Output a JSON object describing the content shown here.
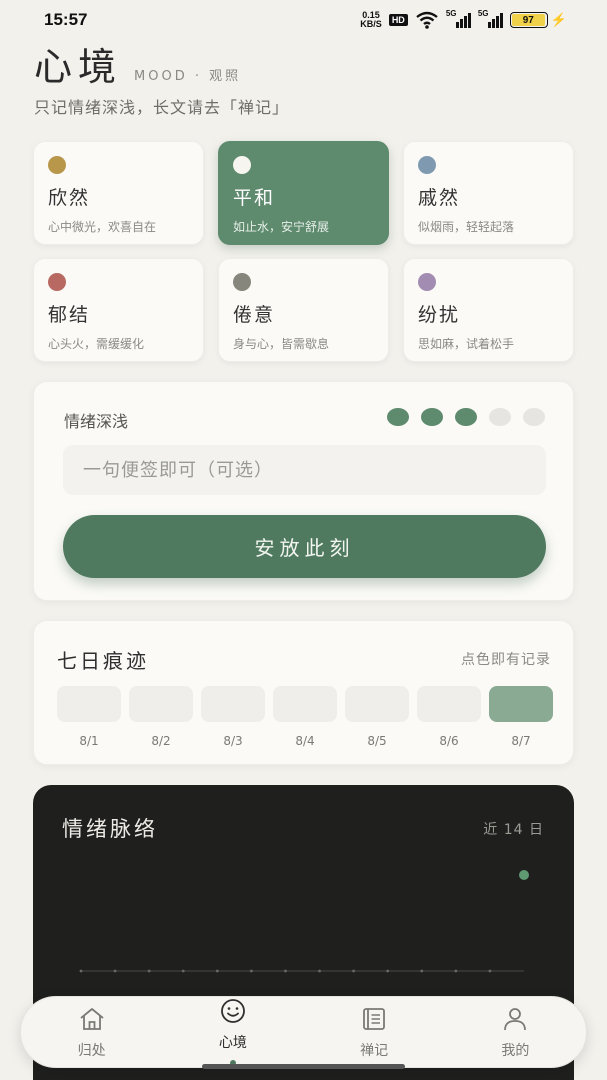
{
  "status_bar": {
    "time": "15:57",
    "net_speed_value": "0.15",
    "net_speed_unit": "KB/S",
    "hd_badge": "HD",
    "signal_1_label": "5G",
    "signal_2_label": "5G",
    "battery_percent": "97"
  },
  "header": {
    "title": "心境",
    "subtitle": "MOOD · 观照",
    "tagline": "只记情绪深浅，长文请去「禅记」"
  },
  "moods": [
    {
      "name": "欣然",
      "desc": "心中微光，欢喜自在",
      "color": "#b9974a",
      "selected": false
    },
    {
      "name": "平和",
      "desc": "如止水，安宁舒展",
      "color": "#f7f5ef",
      "selected": true
    },
    {
      "name": "戚然",
      "desc": "似烟雨，轻轻起落",
      "color": "#7f9ab0",
      "selected": false
    },
    {
      "name": "郁结",
      "desc": "心头火，需缓缓化",
      "color": "#b86a62",
      "selected": false
    },
    {
      "name": "倦意",
      "desc": "身与心，皆需歇息",
      "color": "#86867c",
      "selected": false
    },
    {
      "name": "纷扰",
      "desc": "思如麻，试着松手",
      "color": "#a38cb2",
      "selected": false
    }
  ],
  "intensity": {
    "label": "情绪深浅",
    "level": 3,
    "max": 5,
    "note_placeholder": "一句便签即可（可选）",
    "note_value": "",
    "submit_label": "安放此刻"
  },
  "week": {
    "title": "七日痕迹",
    "hint": "点色即有记录",
    "days": [
      {
        "label": "8/1",
        "recorded": false
      },
      {
        "label": "8/2",
        "recorded": false
      },
      {
        "label": "8/3",
        "recorded": false
      },
      {
        "label": "8/4",
        "recorded": false
      },
      {
        "label": "8/5",
        "recorded": false
      },
      {
        "label": "8/6",
        "recorded": false
      },
      {
        "label": "8/7",
        "recorded": true
      }
    ]
  },
  "trend": {
    "title": "情绪脉络",
    "range": "近 14 日"
  },
  "chart_data": {
    "type": "line",
    "title": "情绪脉络",
    "x_count": 14,
    "values": [
      null,
      null,
      null,
      null,
      null,
      null,
      null,
      null,
      null,
      null,
      null,
      null,
      null,
      3
    ],
    "ylim": [
      0,
      5
    ]
  },
  "tabs": [
    {
      "label": "归处",
      "icon": "home-icon",
      "active": false
    },
    {
      "label": "心境",
      "icon": "smile-icon",
      "active": true
    },
    {
      "label": "禅记",
      "icon": "journal-icon",
      "active": false
    },
    {
      "label": "我的",
      "icon": "user-icon",
      "active": false
    }
  ],
  "colors": {
    "accent": "#4f7a5f",
    "selected_card": "#5e8a6e",
    "dark_card": "#1f1f1e"
  }
}
